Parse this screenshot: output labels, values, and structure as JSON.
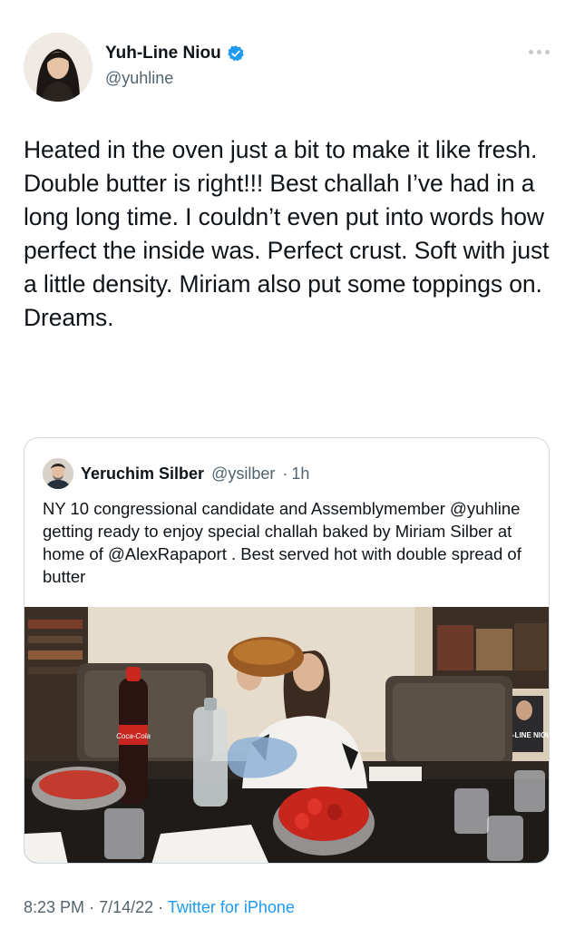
{
  "author": {
    "name": "Yuh-Line Niou",
    "handle": "@yuhline",
    "verified": true,
    "accent_color": "#1d9bf0"
  },
  "tweet": {
    "text": "Heated in the oven just a bit to make it like fresh. Double butter is right!!! Best challah I’ve had in a long long time. I couldn’t even put into words how perfect the inside was. Perfect crust. Soft with just a little density. Miriam also put some toppings on. Dreams."
  },
  "quote": {
    "name": "Yeruchim Silber",
    "handle": "@ysilber",
    "separator": "·",
    "time": "1h",
    "text": "NY 10 congressional candidate and Assemblymember @yuhline getting ready to enjoy special challah baked by Miriam Silber at home of @AlexRapaport . Best served hot with double spread of butter",
    "photo": {
      "bottle_label": "Coca-Cola",
      "poster_text": "YUH-LINE NIOU"
    }
  },
  "footer": {
    "time": "8:23 PM",
    "date": "7/14/22",
    "separator": "·",
    "source": "Twitter for iPhone"
  },
  "icons": {
    "verified": "verified-badge-icon",
    "more": "more-options-icon"
  }
}
